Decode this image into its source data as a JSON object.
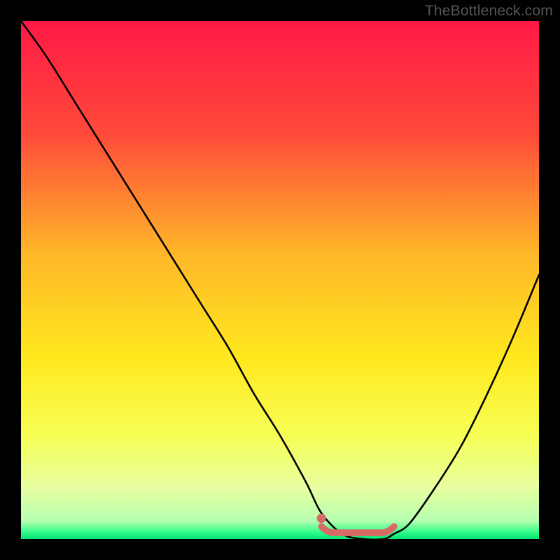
{
  "watermark": "TheBottleneck.com",
  "chart_data": {
    "type": "line",
    "title": "",
    "xlabel": "",
    "ylabel": "",
    "xlim": [
      0,
      100
    ],
    "ylim": [
      0,
      100
    ],
    "gradient_stops": [
      {
        "pos": 0,
        "color": "#ff1846"
      },
      {
        "pos": 0.22,
        "color": "#ff4b3a"
      },
      {
        "pos": 0.45,
        "color": "#ffb829"
      },
      {
        "pos": 0.65,
        "color": "#ffe81e"
      },
      {
        "pos": 0.8,
        "color": "#f6ff55"
      },
      {
        "pos": 0.9,
        "color": "#e8ffa0"
      },
      {
        "pos": 0.965,
        "color": "#b6ffb0"
      },
      {
        "pos": 0.985,
        "color": "#3cff8d"
      },
      {
        "pos": 1.0,
        "color": "#00e574"
      }
    ],
    "series": [
      {
        "name": "bottleneck-curve",
        "x": [
          0,
          5,
          10,
          15,
          20,
          25,
          30,
          35,
          40,
          45,
          50,
          55,
          58,
          62,
          66,
          70,
          72,
          75,
          80,
          85,
          90,
          95,
          100
        ],
        "y": [
          100,
          93,
          85,
          77,
          69,
          61,
          53,
          45,
          37,
          28,
          20,
          11,
          5,
          1,
          0,
          0,
          1,
          3,
          10,
          18,
          28,
          39,
          51
        ]
      }
    ],
    "marker": {
      "x_range": [
        58,
        72
      ],
      "y_level": 1.2,
      "color": "#d86a66",
      "dot_x": 58,
      "dot_y": 4
    }
  }
}
